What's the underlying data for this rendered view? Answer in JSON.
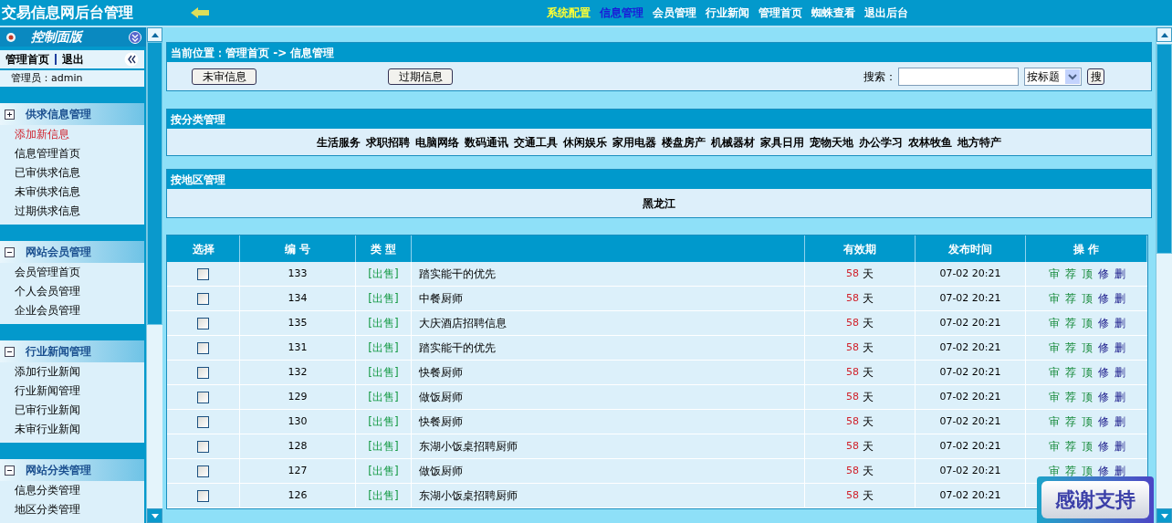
{
  "header": {
    "title": "交易信息网后台管理",
    "nav": [
      {
        "label": "系统配置",
        "selected": false,
        "kind": "config"
      },
      {
        "label": "信息管理",
        "selected": true,
        "kind": "link"
      },
      {
        "label": "会员管理",
        "selected": false,
        "kind": "link"
      },
      {
        "label": "行业新闻",
        "selected": false,
        "kind": "link"
      },
      {
        "label": "管理首页",
        "selected": false,
        "kind": "link"
      },
      {
        "label": "蜘蛛查看",
        "selected": false,
        "kind": "link"
      },
      {
        "label": "退出后台",
        "selected": false,
        "kind": "link"
      }
    ]
  },
  "sidebar": {
    "panel_title": "控制面版",
    "tabs": [
      "管理首页",
      "退出"
    ],
    "admin": "管理员：admin",
    "groups": [
      {
        "title": "供求信息管理",
        "expanded": false,
        "items": [
          {
            "label": "添加新信息",
            "selected": true
          },
          {
            "label": "信息管理首页",
            "selected": false
          },
          {
            "label": "已审供求信息",
            "selected": false
          },
          {
            "label": "未审供求信息",
            "selected": false
          },
          {
            "label": "过期供求信息",
            "selected": false
          }
        ]
      },
      {
        "title": "网站会员管理",
        "expanded": true,
        "items": [
          {
            "label": "会员管理首页",
            "selected": false
          },
          {
            "label": "个人会员管理",
            "selected": false
          },
          {
            "label": "企业会员管理",
            "selected": false
          }
        ]
      },
      {
        "title": "行业新闻管理",
        "expanded": true,
        "items": [
          {
            "label": "添加行业新闻",
            "selected": false
          },
          {
            "label": "行业新闻管理",
            "selected": false
          },
          {
            "label": "已审行业新闻",
            "selected": false
          },
          {
            "label": "未审行业新闻",
            "selected": false
          }
        ]
      },
      {
        "title": "网站分类管理",
        "expanded": true,
        "items": [
          {
            "label": "信息分类管理",
            "selected": false
          },
          {
            "label": "地区分类管理",
            "selected": false
          }
        ]
      }
    ]
  },
  "main": {
    "breadcrumb": "当前位置：管理首页 -> 信息管理",
    "buttons": [
      "未审信息",
      "过期信息"
    ],
    "search": {
      "label": "搜索：",
      "select": "按标题",
      "button": "搜"
    },
    "categories": {
      "title": "按分类管理",
      "items": [
        "生活服务",
        "求职招聘",
        "电脑网络",
        "数码通讯",
        "交通工具",
        "休闲娱乐",
        "家用电器",
        "楼盘房产",
        "机械器材",
        "家具日用",
        "宠物天地",
        "办公学习",
        "农林牧鱼",
        "地方特产"
      ]
    },
    "regions": {
      "title": "按地区管理",
      "items": [
        "黑龙江"
      ]
    },
    "table": {
      "columns": [
        "选择",
        "编 号",
        "类 型",
        "有效期",
        "发布时间",
        "操 作"
      ],
      "rows": [
        {
          "checked": false,
          "id": "133",
          "type": "[出售]",
          "title": "踏实能干的优先",
          "days": "58",
          "unit": "天",
          "time": "07-02 20:21",
          "actions": [
            "审",
            "荐",
            "顶",
            "修",
            "删"
          ]
        },
        {
          "checked": false,
          "id": "134",
          "type": "[出售]",
          "title": "中餐厨师",
          "days": "58",
          "unit": "天",
          "time": "07-02 20:21",
          "actions": [
            "审",
            "荐",
            "顶",
            "修",
            "删"
          ]
        },
        {
          "checked": false,
          "id": "135",
          "type": "[出售]",
          "title": "大庆酒店招聘信息",
          "days": "58",
          "unit": "天",
          "time": "07-02 20:21",
          "actions": [
            "审",
            "荐",
            "顶",
            "修",
            "删"
          ]
        },
        {
          "checked": false,
          "id": "131",
          "type": "[出售]",
          "title": "踏实能干的优先",
          "days": "58",
          "unit": "天",
          "time": "07-02 20:21",
          "actions": [
            "审",
            "荐",
            "顶",
            "修",
            "删"
          ]
        },
        {
          "checked": false,
          "id": "132",
          "type": "[出售]",
          "title": "快餐厨师",
          "days": "58",
          "unit": "天",
          "time": "07-02 20:21",
          "actions": [
            "审",
            "荐",
            "顶",
            "修",
            "删"
          ]
        },
        {
          "checked": false,
          "id": "129",
          "type": "[出售]",
          "title": "做饭厨师",
          "days": "58",
          "unit": "天",
          "time": "07-02 20:21",
          "actions": [
            "审",
            "荐",
            "顶",
            "修",
            "删"
          ]
        },
        {
          "checked": false,
          "id": "130",
          "type": "[出售]",
          "title": "快餐厨师",
          "days": "58",
          "unit": "天",
          "time": "07-02 20:21",
          "actions": [
            "审",
            "荐",
            "顶",
            "修",
            "删"
          ]
        },
        {
          "checked": false,
          "id": "128",
          "type": "[出售]",
          "title": "东湖小饭桌招聘厨师",
          "days": "58",
          "unit": "天",
          "time": "07-02 20:21",
          "actions": [
            "审",
            "荐",
            "顶",
            "修",
            "删"
          ]
        },
        {
          "checked": false,
          "id": "127",
          "type": "[出售]",
          "title": "做饭厨师",
          "days": "58",
          "unit": "天",
          "time": "07-02 20:21",
          "actions": [
            "审",
            "荐",
            "顶",
            "修",
            "删"
          ]
        },
        {
          "checked": false,
          "id": "126",
          "type": "[出售]",
          "title": "东湖小饭桌招聘厨师",
          "days": "58",
          "unit": "天",
          "time": "07-02 20:21",
          "actions": []
        }
      ]
    }
  },
  "badge": "感谢支持"
}
